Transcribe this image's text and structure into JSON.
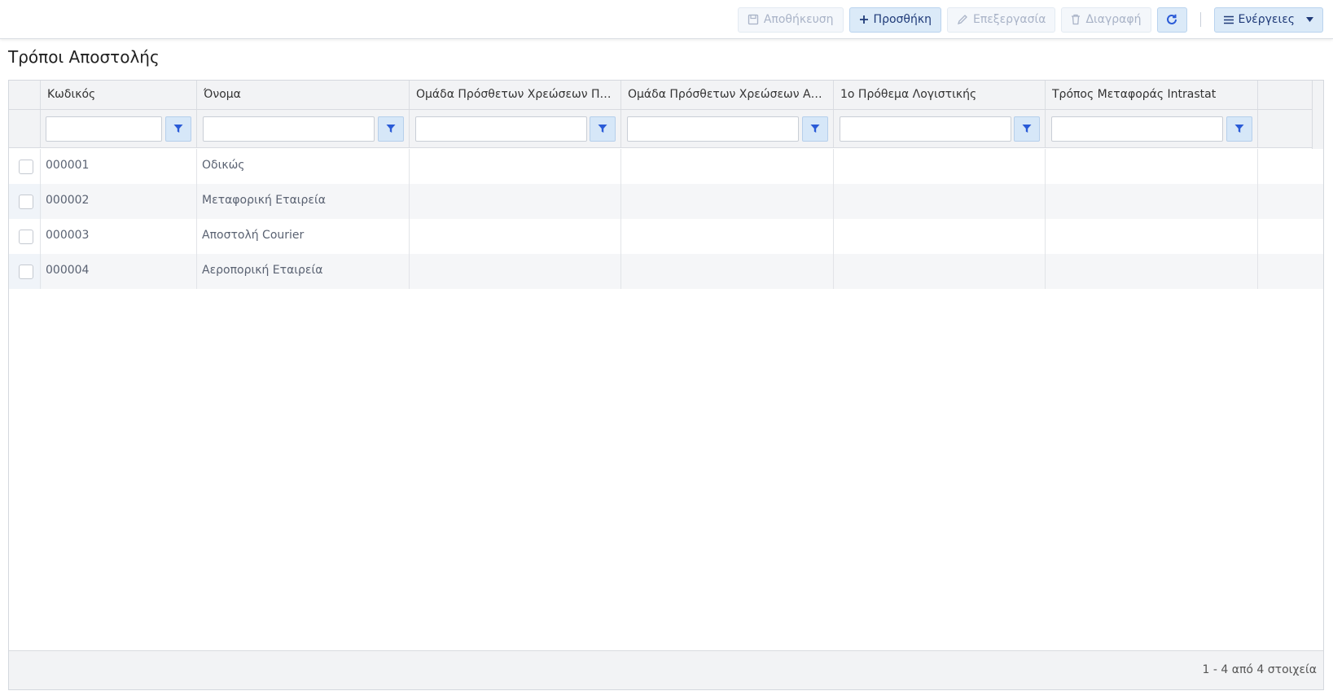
{
  "toolbar": {
    "save_label": "Αποθήκευση",
    "add_label": "Προσθήκη",
    "edit_label": "Επεξεργασία",
    "delete_label": "Διαγραφή",
    "actions_label": "Ενέργειες"
  },
  "page": {
    "title": "Τρόποι Αποστολής"
  },
  "grid": {
    "columns": [
      "Κωδικός",
      "Όνομα",
      "Ομάδα Πρόσθετων Χρεώσεων Πωλήσ...",
      "Ομάδα Πρόσθετων Χρεώσεων Αγορών",
      "1ο Πρόθεμα Λογιστικής",
      "Τρόπος Μεταφοράς Intrastat"
    ],
    "rows": [
      {
        "code": "000001",
        "name": "Οδικώς"
      },
      {
        "code": "000002",
        "name": "Μεταφορική Εταιρεία"
      },
      {
        "code": "000003",
        "name": "Αποστολή Courier"
      },
      {
        "code": "000004",
        "name": "Αεροπορική Εταιρεία"
      }
    ],
    "pager_info": "1 - 4 από 4 στοιχεία"
  },
  "colors": {
    "accent": "#2a5bd7",
    "filter_button_bg": "#d6e7f8",
    "alt_row_bg": "#f5f6f8"
  }
}
